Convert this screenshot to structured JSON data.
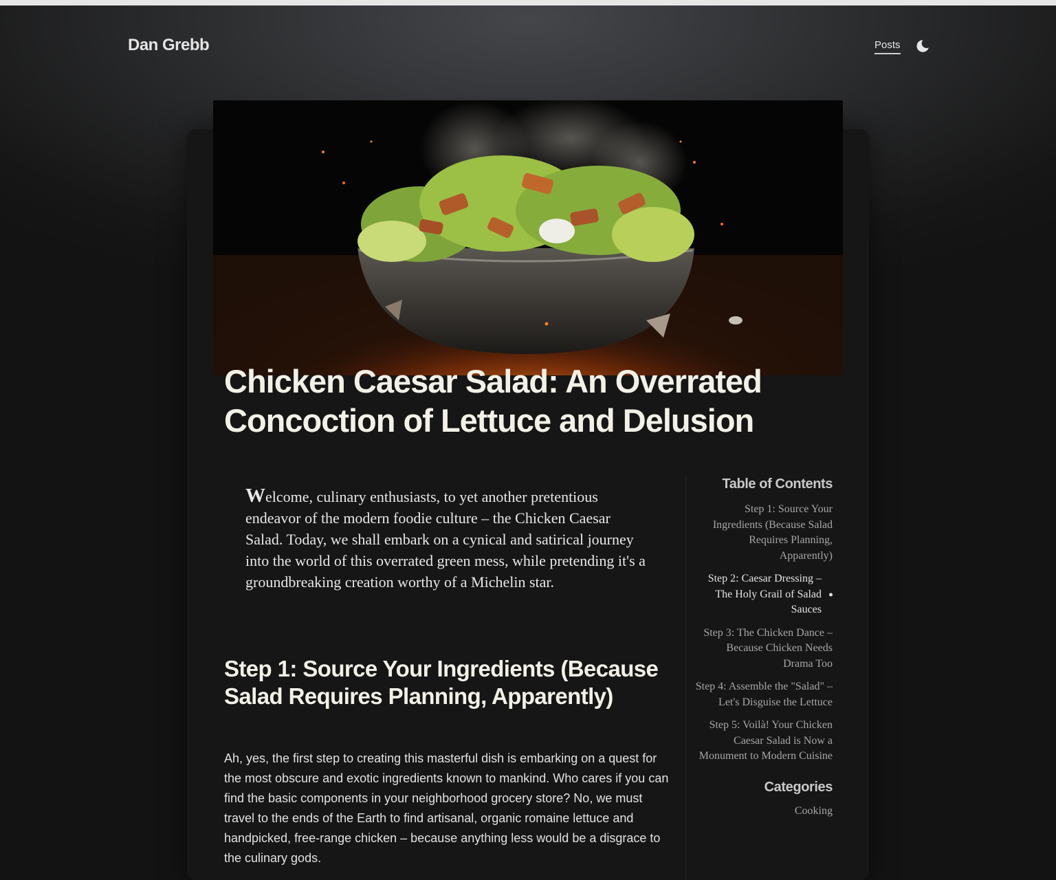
{
  "site": {
    "brand": "Dan Grebb"
  },
  "nav": {
    "posts_label": "Posts",
    "theme_icon": "moon-icon"
  },
  "hero": {
    "icon": "caesar-salad-hero-image"
  },
  "post": {
    "title": "Chicken Caesar Salad: An Overrated Concoction of Lettuce and Delusion",
    "intro_drop": "W",
    "intro_rest": "elcome, culinary enthusiasts, to yet another pretentious endeavor of the modern foodie culture – the Chicken Caesar Salad. Today, we shall embark on a cynical and satirical journey into the world of this overrated green mess, while pretending it's a groundbreaking creation worthy of a Michelin star.",
    "step1_heading": "Step 1: Source Your Ingredients (Because Salad Requires Planning, Apparently)",
    "step1_body": "Ah, yes, the first step to creating this masterful dish is embarking on a quest for the most obscure and exotic ingredients known to mankind. Who cares if you can find the basic components in your neighborhood grocery store? No, we must travel to the ends of the Earth to find artisanal, organic romaine lettuce and handpicked, free-range chicken – because anything less would be a disgrace to the culinary gods."
  },
  "sidebar": {
    "toc_title": "Table of Contents",
    "toc": [
      "Step 1: Source Your Ingredients (Because Salad Requires Planning, Apparently)",
      "Step 2: Caesar Dressing – The Holy Grail of Salad Sauces",
      "Step 3: The Chicken Dance – Because Chicken Needs Drama Too",
      "Step 4: Assemble the \"Salad\" – Let's Disguise the Lettuce",
      "Step 5: Voilà! Your Chicken Caesar Salad is Now a Monument to Modern Cuisine"
    ],
    "active_index": 1,
    "categories_title": "Categories",
    "categories": [
      "Cooking"
    ]
  },
  "colors": {
    "background": "#131313",
    "card": "#161616",
    "title": "#f3f1e7",
    "toc_text": "#a7a7a7",
    "toc_active": "#e4e4e4"
  }
}
